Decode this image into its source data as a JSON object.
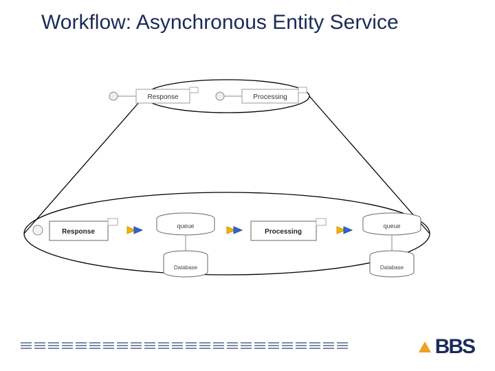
{
  "title": "Workflow: Asynchronous Entity Service",
  "diagram": {
    "top": {
      "response": "Response",
      "processing": "Processing"
    },
    "bottom": {
      "response": "Response",
      "queue1": "queue",
      "database1": "Database",
      "processing": "Processing",
      "queue2": "queue",
      "database2": "Database"
    }
  },
  "footer": {
    "logo": "BBS"
  }
}
